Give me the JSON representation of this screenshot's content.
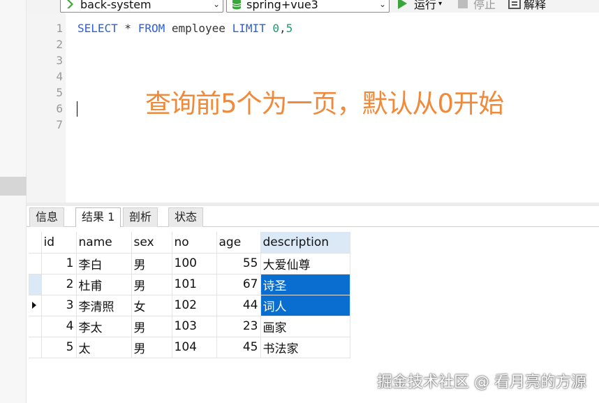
{
  "toolbar": {
    "connection": "back-system",
    "database": "spring+vue3",
    "run_label": "运行",
    "run_dropdown": "▾",
    "stop_label": "停止",
    "explain_label": "解释"
  },
  "editor": {
    "line_numbers": [
      "1",
      "2",
      "3",
      "4",
      "5",
      "6",
      "7"
    ],
    "sql": {
      "select": "SELECT",
      "star": " * ",
      "from": "FROM",
      "table": " employee ",
      "limit": "LIMIT",
      "args_a": " 0",
      "comma": ",",
      "args_b": "5"
    },
    "annotation": "查询前5个为一页，默认从0开始"
  },
  "tabs": [
    "信息",
    "结果 1",
    "剖析",
    "状态"
  ],
  "result": {
    "columns": [
      "id",
      "name",
      "sex",
      "no",
      "age",
      "description"
    ],
    "rows": [
      [
        "1",
        "李白",
        "男",
        "100",
        "55",
        "大爱仙尊"
      ],
      [
        "2",
        "杜甫",
        "男",
        "101",
        "67",
        "诗圣"
      ],
      [
        "3",
        "李清照",
        "女",
        "102",
        "44",
        "词人"
      ],
      [
        "4",
        "李太",
        "男",
        "103",
        "23",
        "画家"
      ],
      [
        "5",
        "太",
        "男",
        "104",
        "45",
        "书法家"
      ]
    ]
  },
  "watermark": "掘金技术社区 @ 看月亮的方源",
  "colors": {
    "keyword": "#2d5fd1",
    "number": "#1e9b6a",
    "annotation": "#f08a3a",
    "selection": "#0a6ed1",
    "run_icon": "#3aa53a"
  }
}
